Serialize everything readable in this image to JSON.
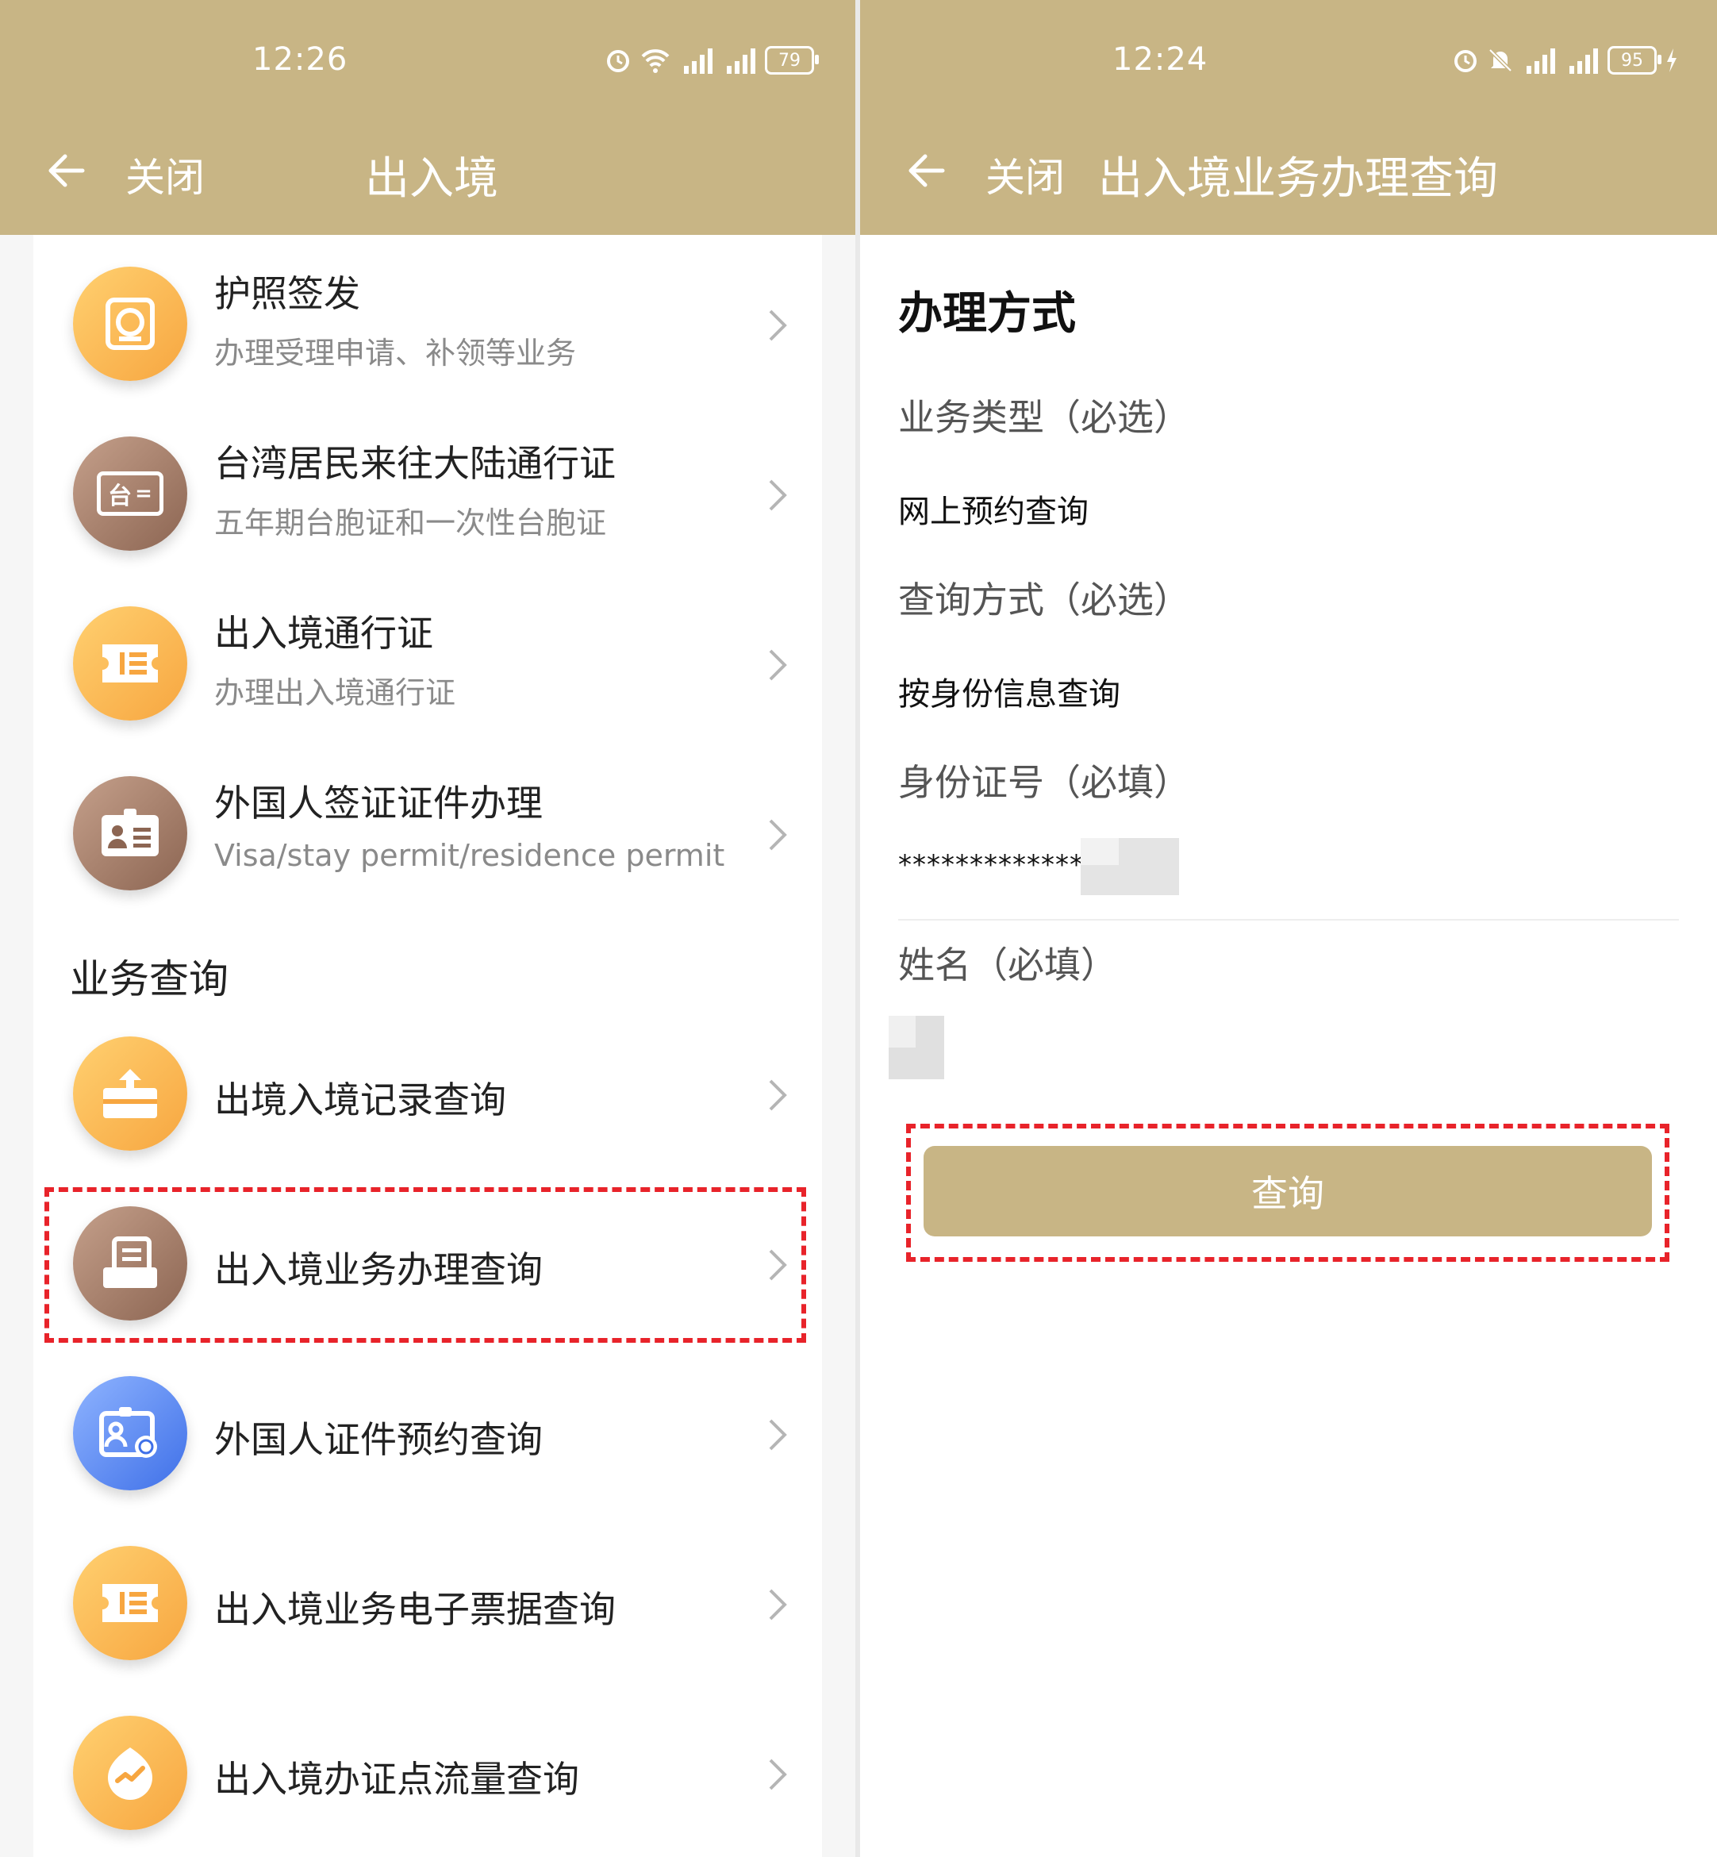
{
  "left_screen": {
    "status_time": "12:26",
    "battery": "79",
    "nav": {
      "close_label": "关闭",
      "title": "出入境"
    },
    "items": [
      {
        "title": "护照签发",
        "subtitle": "办理受理申请、补领等业务",
        "icon": "passport-icon"
      },
      {
        "title": "台湾居民来往大陆通行证",
        "subtitle": "五年期台胞证和一次性台胞证",
        "icon": "taiwan-permit-icon",
        "icon_text": "台"
      },
      {
        "title": "出入境通行证",
        "subtitle": "办理出入境通行证",
        "icon": "ticket-icon"
      },
      {
        "title": "外国人签证证件办理",
        "subtitle": "Visa/stay permit/residence permit",
        "icon": "id-card-icon"
      }
    ],
    "section_title": "业务查询",
    "query_items": [
      {
        "title": "出境入境记录查询",
        "icon": "record-icon"
      },
      {
        "title": "出入境业务办理查询",
        "icon": "business-query-icon"
      },
      {
        "title": "外国人证件预约查询",
        "icon": "foreigner-appointment-icon"
      },
      {
        "title": "出入境业务电子票据查询",
        "icon": "e-receipt-icon"
      },
      {
        "title": "出入境办证点流量查询",
        "icon": "traffic-icon"
      }
    ]
  },
  "right_screen": {
    "status_time": "12:24",
    "battery": "95",
    "nav": {
      "close_label": "关闭",
      "title": "出入境业务办理查询"
    },
    "form": {
      "section_title": "办理方式",
      "business_type_label": "业务类型（必选）",
      "business_type_value": "网上预约查询",
      "query_method_label": "查询方式（必选）",
      "query_method_value": "按身份信息查询",
      "id_number_label": "身份证号（必填）",
      "id_number_value": "*************",
      "name_label": "姓名（必填）",
      "submit_label": "查询"
    }
  },
  "colors": {
    "header": "#c8b585",
    "highlight": "#e8232a",
    "orange_icon": "#f7a640",
    "brown_icon": "#8c6552",
    "blue_icon": "#3f70e8"
  }
}
